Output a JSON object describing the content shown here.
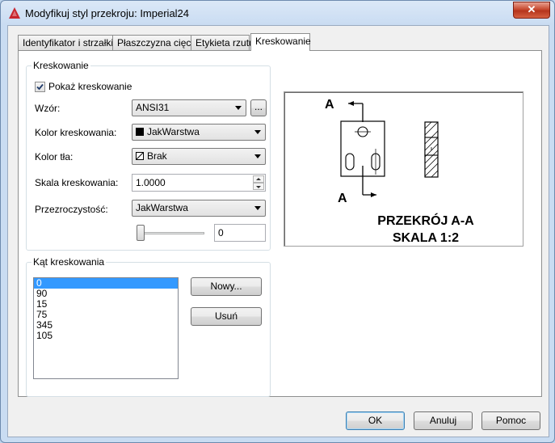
{
  "window": {
    "title": "Modyfikuj styl przekroju: Imperial24",
    "close_label": "✕"
  },
  "tabs": [
    {
      "label": "Identyfikator i strzałki"
    },
    {
      "label": "Płaszczyzna cięcia"
    },
    {
      "label": "Etykieta rzutu"
    },
    {
      "label": "Kreskowanie"
    }
  ],
  "hatch_group": {
    "title": "Kreskowanie",
    "show_hatch_label": "Pokaż kreskowanie",
    "show_hatch_checked": true,
    "pattern_label": "Wzór:",
    "pattern_value": "ANSI31",
    "browse_label": "...",
    "color_label": "Kolor kreskowania:",
    "color_value": "JakWarstwa",
    "bg_color_label": "Kolor tła:",
    "bg_color_value": "Brak",
    "scale_label": "Skala kreskowania:",
    "scale_value": "1.0000",
    "transparency_label": "Przezroczystość:",
    "transparency_value": "JakWarstwa",
    "transparency_slider_value": "0"
  },
  "angle_group": {
    "title": "Kąt kreskowania",
    "angles": [
      "0",
      "90",
      "15",
      "75",
      "345",
      "105"
    ],
    "selected_index": 0,
    "new_label": "Nowy...",
    "delete_label": "Usuń"
  },
  "preview": {
    "label_a_top": "A",
    "label_a_bottom": "A",
    "caption_line1": "PRZEKRÓJ A-A",
    "caption_line2": "SKALA 1:2"
  },
  "footer": {
    "ok_label": "OK",
    "cancel_label": "Anuluj",
    "help_label": "Pomoc"
  },
  "colors": {
    "accent_selection": "#3399ff",
    "autocad_red": "#c8262e"
  }
}
